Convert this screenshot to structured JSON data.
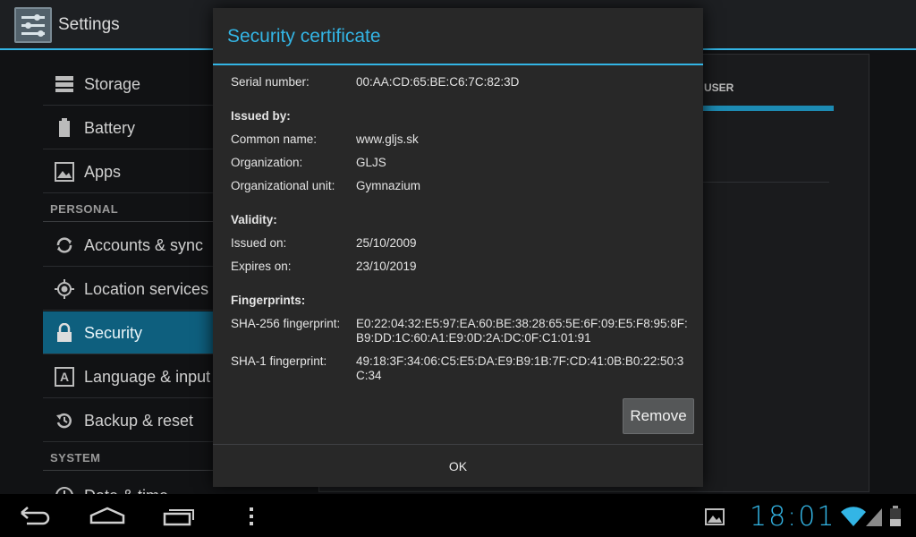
{
  "actionbar": {
    "title": "Settings",
    "icon": "settings-sliders-icon"
  },
  "settings": {
    "items_top": [
      {
        "label": "Storage",
        "icon": "storage-icon"
      },
      {
        "label": "Battery",
        "icon": "battery-icon"
      },
      {
        "label": "Apps",
        "icon": "apps-icon"
      }
    ],
    "personal_header": "PERSONAL",
    "items_personal": [
      {
        "label": "Accounts & sync",
        "icon": "sync-icon"
      },
      {
        "label": "Location services",
        "icon": "location-icon"
      },
      {
        "label": "Security",
        "icon": "lock-icon",
        "selected": true
      },
      {
        "label": "Language & input",
        "icon": "keyboard-icon"
      },
      {
        "label": "Backup & reset",
        "icon": "backup-icon"
      }
    ],
    "system_header": "SYSTEM",
    "items_system": [
      {
        "label": "Date & time",
        "icon": "clock-icon"
      }
    ]
  },
  "right_panel": {
    "tab_label": "USER"
  },
  "dialog": {
    "title": "Security certificate",
    "serial_label": "Serial number:",
    "serial_value": "00:AA:CD:65:BE:C6:7C:82:3D",
    "issued_by_header": "Issued by:",
    "common_name_label": "Common name:",
    "common_name_value": "www.gljs.sk",
    "organization_label": "Organization:",
    "organization_value": "GLJS",
    "org_unit_label": "Organizational unit:",
    "org_unit_value": "Gymnazium",
    "validity_header": "Validity:",
    "issued_on_label": "Issued on:",
    "issued_on_value": "25/10/2009",
    "expires_on_label": "Expires on:",
    "expires_on_value": "23/10/2019",
    "fingerprints_header": "Fingerprints:",
    "sha256_label": "SHA-256 fingerprint:",
    "sha256_value": "E0:22:04:32:E5:97:EA:60:BE:38:28:65:5E:6F:09:E5:F8:95:8F:B9:DD:1C:60:A1:E9:0D:2A:DC:0F:C1:01:91",
    "sha1_label": "SHA-1 fingerprint:",
    "sha1_value": "49:18:3F:34:06:C5:E5:DA:E9:B9:1B:7F:CD:41:0B:B0:22:50:3C:34",
    "remove_label": "Remove",
    "ok_label": "OK"
  },
  "sysbar": {
    "time": "18:01",
    "nav": [
      "back-icon",
      "home-icon",
      "recent-apps-icon",
      "menu-icon"
    ],
    "status_icons": [
      "gallery-notification-icon",
      "wifi-icon",
      "signal-icon",
      "battery-status-icon"
    ]
  },
  "colors": {
    "accent": "#33b5e5",
    "selected_item": "#0e5f7e",
    "dialog_bg": "#282828"
  }
}
